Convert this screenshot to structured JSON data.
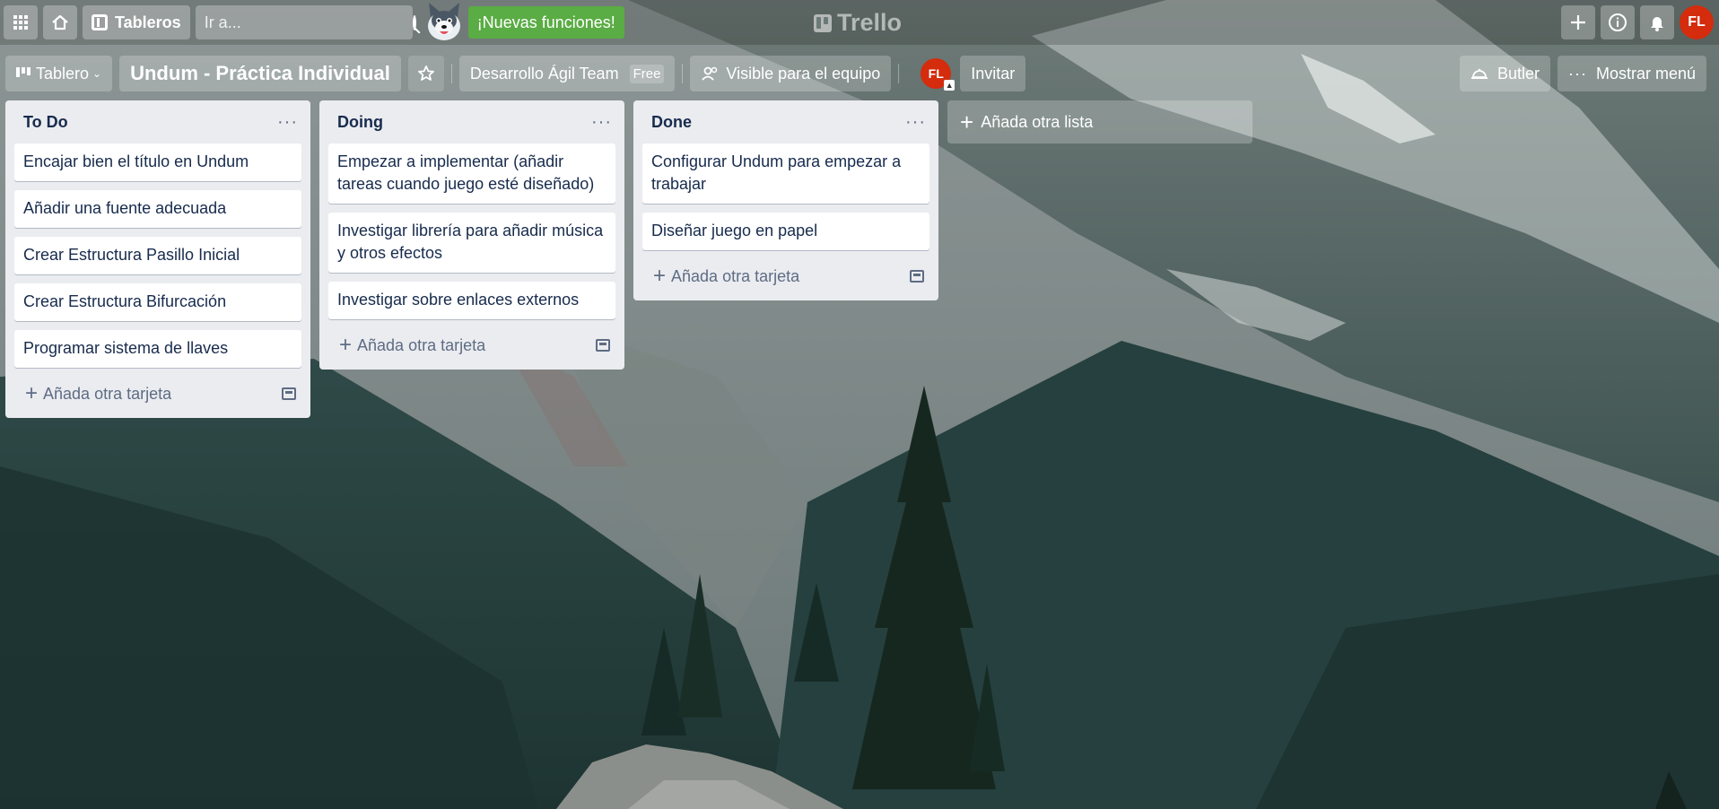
{
  "header": {
    "search_placeholder": "Ir a...",
    "boards_label": "Tableros",
    "new_features_label": "¡Nuevas funciones!",
    "logo_text": "Trello",
    "user_initials": "FL"
  },
  "board": {
    "view_label": "Tablero",
    "title": "Undum - Práctica Individual",
    "team_name": "Desarrollo Ágil Team",
    "team_plan": "Free",
    "visibility_label": "Visible para el equipo",
    "member_initials": "FL",
    "invite_label": "Invitar",
    "butler_label": "Butler",
    "show_menu_label": "Mostrar menú"
  },
  "lists": [
    {
      "title": "To Do",
      "cards": [
        "Encajar bien el título en Undum",
        "Añadir una fuente adecuada",
        "Crear Estructura Pasillo Inicial",
        "Crear Estructura Bifurcación",
        "Programar sistema de llaves"
      ],
      "add_card_label": "Añada otra tarjeta"
    },
    {
      "title": "Doing",
      "cards": [
        "Empezar a implementar (añadir tareas cuando juego esté diseñado)",
        "Investigar librería para añadir música y otros efectos",
        "Investigar sobre enlaces externos"
      ],
      "add_card_label": "Añada otra tarjeta"
    },
    {
      "title": "Done",
      "cards": [
        "Configurar Undum para empezar a trabajar",
        "Diseñar juego en papel"
      ],
      "add_card_label": "Añada otra tarjeta"
    }
  ],
  "add_list_label": "Añada otra lista",
  "colors": {
    "list_bg": "#ebecf0",
    "new_features_green": "#5aac44",
    "avatar_red": "#d42c0d"
  }
}
